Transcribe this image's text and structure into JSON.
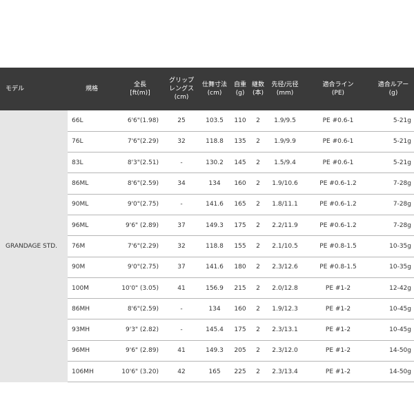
{
  "headers": {
    "model": "モデル",
    "spec": "規格",
    "length_1": "全長",
    "length_2": "[ft(m)]",
    "grip_1": "グリップ",
    "grip_2": "レングス",
    "grip_3": "(cm)",
    "closed_1": "仕舞寸法",
    "closed_2": "(cm)",
    "weight_1": "自重",
    "weight_2": "(g)",
    "pieces_1": "継数",
    "pieces_2": "(本)",
    "diameter_1": "先径/元径",
    "diameter_2": "(mm)",
    "line_1": "適合ライン",
    "line_2": "(PE)",
    "lure_1": "適合ルアー",
    "lure_2": "(g)"
  },
  "model_name": "GRANDAGE STD.",
  "rows": [
    {
      "spec": "66L",
      "length": "6'6\"(1.98)",
      "grip": "25",
      "closed": "103.5",
      "weight": "110",
      "pieces": "2",
      "diameter": "1.9/9.5",
      "line": "PE #0.6-1",
      "lure": "5-21g"
    },
    {
      "spec": "76L",
      "length": "7'6\"(2.29)",
      "grip": "32",
      "closed": "118.8",
      "weight": "135",
      "pieces": "2",
      "diameter": "1.9/9.9",
      "line": "PE #0.6-1",
      "lure": "5-21g"
    },
    {
      "spec": "83L",
      "length": "8'3\"(2.51)",
      "grip": "-",
      "closed": "130.2",
      "weight": "145",
      "pieces": "2",
      "diameter": "1.5/9.4",
      "line": "PE #0.6-1",
      "lure": "5-21g"
    },
    {
      "spec": "86ML",
      "length": "8'6\"(2.59)",
      "grip": "34",
      "closed": "134",
      "weight": "160",
      "pieces": "2",
      "diameter": "1.9/10.6",
      "line": "PE #0.6-1.2",
      "lure": "7-28g"
    },
    {
      "spec": "90ML",
      "length": "9'0\"(2.75)",
      "grip": "-",
      "closed": "141.6",
      "weight": "165",
      "pieces": "2",
      "diameter": "1.8/11.1",
      "line": "PE #0.6-1.2",
      "lure": "7-28g"
    },
    {
      "spec": "96ML",
      "length": "9'6\" (2.89)",
      "grip": "37",
      "closed": "149.3",
      "weight": "175",
      "pieces": "2",
      "diameter": "2.2/11.9",
      "line": "PE #0.6-1.2",
      "lure": "7-28g"
    },
    {
      "spec": "76M",
      "length": "7'6\"(2.29)",
      "grip": "32",
      "closed": "118.8",
      "weight": "155",
      "pieces": "2",
      "diameter": "2.1/10.5",
      "line": "PE #0.8-1.5",
      "lure": "10-35g"
    },
    {
      "spec": "90M",
      "length": "9'0\"(2.75)",
      "grip": "37",
      "closed": "141.6",
      "weight": "180",
      "pieces": "2",
      "diameter": "2.3/12.6",
      "line": "PE #0.8-1.5",
      "lure": "10-35g"
    },
    {
      "spec": "100M",
      "length": "10'0\" (3.05)",
      "grip": "41",
      "closed": "156.9",
      "weight": "215",
      "pieces": "2",
      "diameter": "2.0/12.8",
      "line": "PE #1-2",
      "lure": "12-42g"
    },
    {
      "spec": "86MH",
      "length": "8'6\"(2.59)",
      "grip": "-",
      "closed": "134",
      "weight": "160",
      "pieces": "2",
      "diameter": "1.9/12.3",
      "line": "PE #1-2",
      "lure": "10-45g"
    },
    {
      "spec": "93MH",
      "length": "9'3\" (2.82)",
      "grip": "-",
      "closed": "145.4",
      "weight": "175",
      "pieces": "2",
      "diameter": "2.3/13.1",
      "line": "PE #1-2",
      "lure": "10-45g"
    },
    {
      "spec": "96MH",
      "length": "9'6\" (2.89)",
      "grip": "41",
      "closed": "149.3",
      "weight": "205",
      "pieces": "2",
      "diameter": "2.3/12.0",
      "line": "PE #1-2",
      "lure": "14-50g"
    },
    {
      "spec": "106MH",
      "length": "10'6\" (3.20)",
      "grip": "42",
      "closed": "165",
      "weight": "225",
      "pieces": "2",
      "diameter": "2.3/13.4",
      "line": "PE #1-2",
      "lure": "14-50g"
    }
  ]
}
